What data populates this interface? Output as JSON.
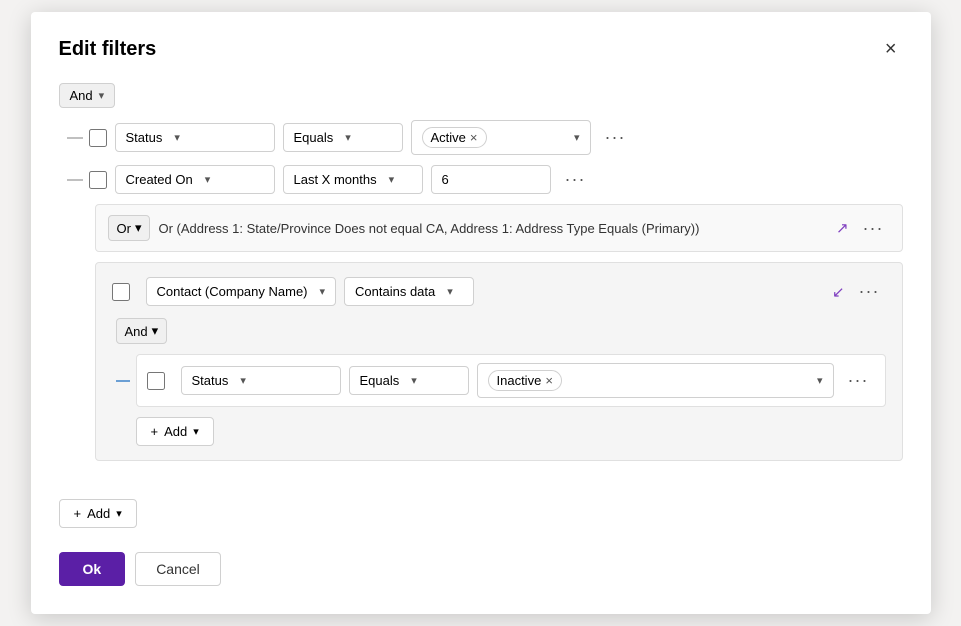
{
  "dialog": {
    "title": "Edit filters",
    "close_label": "×"
  },
  "and_tag": {
    "label": "And",
    "chevron": "▾"
  },
  "filters": [
    {
      "id": "filter1",
      "field": "Status",
      "operator": "Equals",
      "value_chip": "Active",
      "has_chip": true,
      "value_text": ""
    },
    {
      "id": "filter2",
      "field": "Created On",
      "operator": "Last X months",
      "value_chip": "",
      "has_chip": false,
      "value_text": "6"
    }
  ],
  "or_group": {
    "tag": "Or",
    "chevron": "▾",
    "description": "Or (Address 1: State/Province Does not equal CA, Address 1: Address Type Equals (Primary))",
    "expand_icon": "↗"
  },
  "nested_group": {
    "field": "Contact (Company Name)",
    "operator": "Contains data",
    "collapse_icon": "↙",
    "and_tag": "And",
    "and_chevron": "▾",
    "inner_filter": {
      "field": "Status",
      "operator": "Equals",
      "value_chip": "Inactive",
      "has_chip": true
    },
    "add_btn": "+ Add",
    "add_chevron": "▾"
  },
  "bottom_add": {
    "label": "+ Add",
    "chevron": "▾"
  },
  "footer": {
    "ok_label": "Ok",
    "cancel_label": "Cancel"
  }
}
